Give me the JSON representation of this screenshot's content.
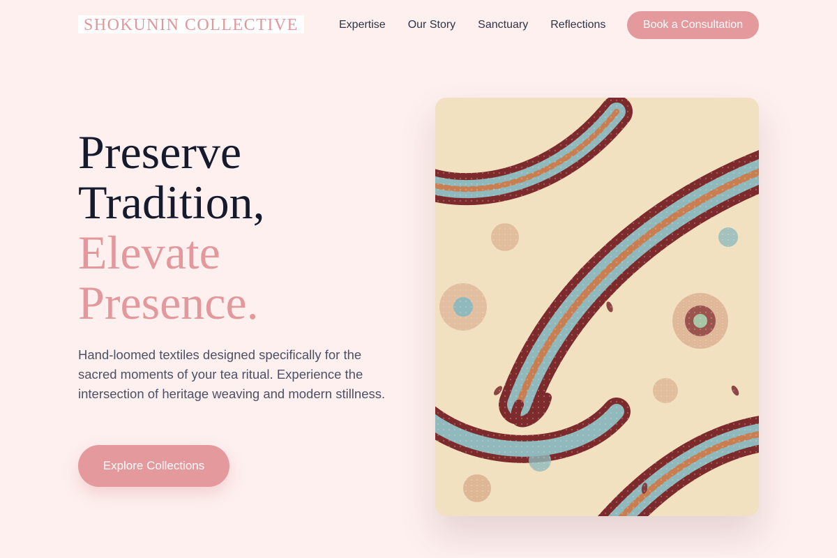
{
  "header": {
    "brand": "SHOKUNIN COLLECTIVE",
    "nav": [
      "Expertise",
      "Our Story",
      "Sanctuary",
      "Reflections"
    ],
    "cta": "Book a Consultation"
  },
  "hero": {
    "title_line1": "Preserve",
    "title_line2": "Tradition,",
    "title_line3": "Elevate",
    "title_line4": "Presence.",
    "body": "Hand-loomed textiles designed specifically for the sacred moments of your tea ritual. Experience the intersection of heritage weaving and modern stillness.",
    "cta": "Explore Collections"
  },
  "image": {
    "icon": "paisley-textile-image"
  },
  "colors": {
    "background": "#fdf0ef",
    "accent": "#e4999c",
    "heading": "#151a2d",
    "body_text": "#4c5064"
  }
}
